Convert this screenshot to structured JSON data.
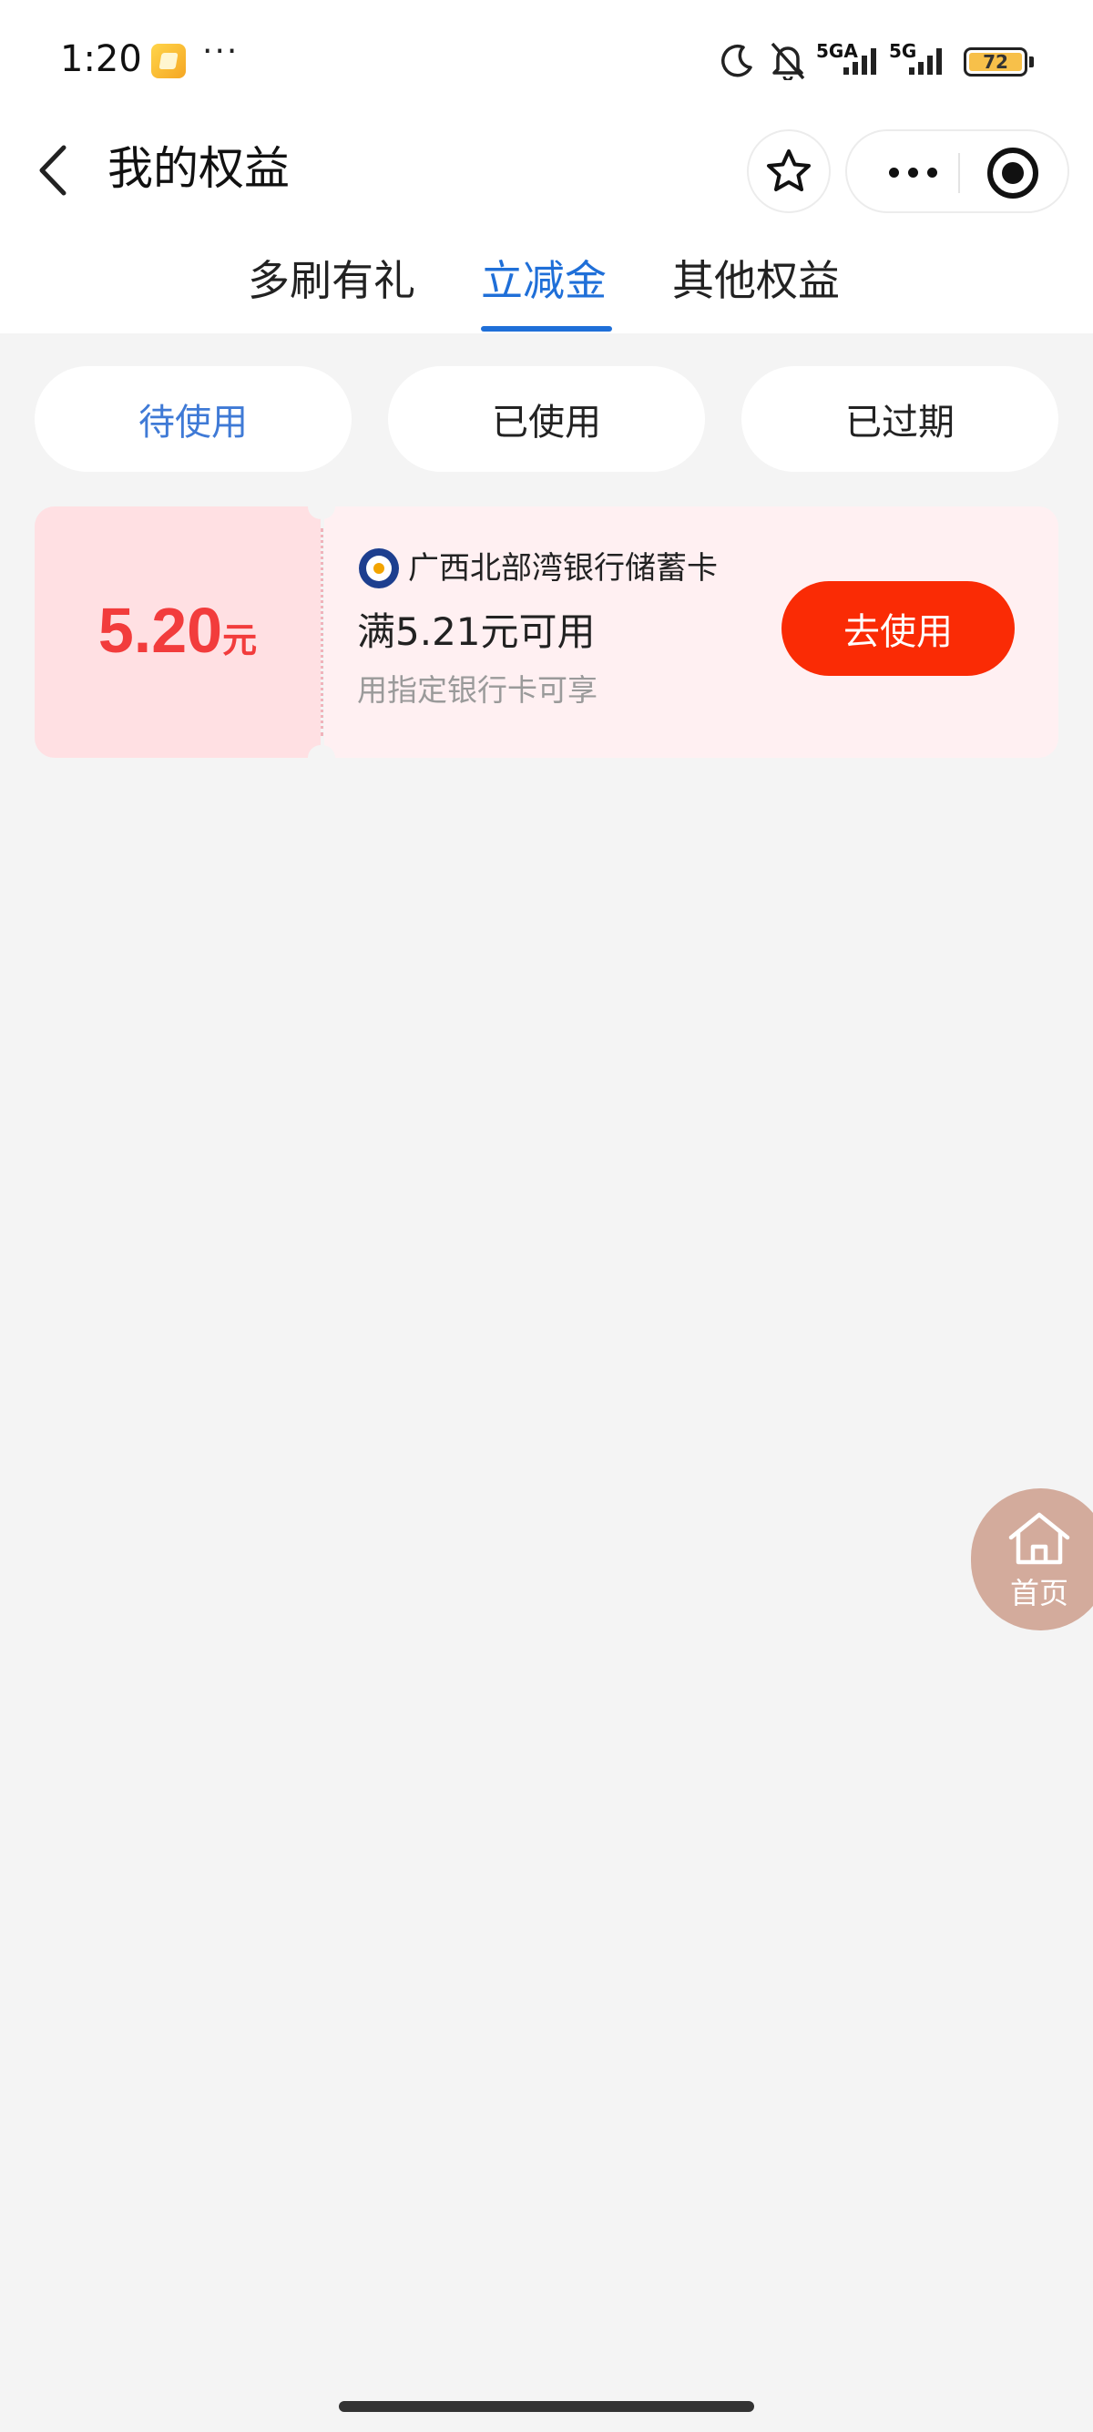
{
  "status_bar": {
    "time": "1:20",
    "more": "···",
    "signal1_label": "5GA",
    "signal2_label": "5G",
    "battery": "72"
  },
  "header": {
    "title": "我的权益"
  },
  "tabs": [
    {
      "label": "多刷有礼",
      "active": false
    },
    {
      "label": "立减金",
      "active": true
    },
    {
      "label": "其他权益",
      "active": false
    }
  ],
  "filters": [
    {
      "label": "待使用",
      "active": true
    },
    {
      "label": "已使用",
      "active": false
    },
    {
      "label": "已过期",
      "active": false
    }
  ],
  "coupon": {
    "amount": "5.20",
    "unit": "元",
    "bank_name": "广西北部湾银行储蓄卡",
    "condition": "满5.21元可用",
    "note": "用指定银行卡可享",
    "button_label": "去使用"
  },
  "home_float": {
    "label": "首页"
  },
  "colors": {
    "accent_blue": "#1f6fd8",
    "coupon_red": "#f23c3c",
    "button_red": "#fa2b05",
    "page_bg": "#f4f4f4"
  }
}
